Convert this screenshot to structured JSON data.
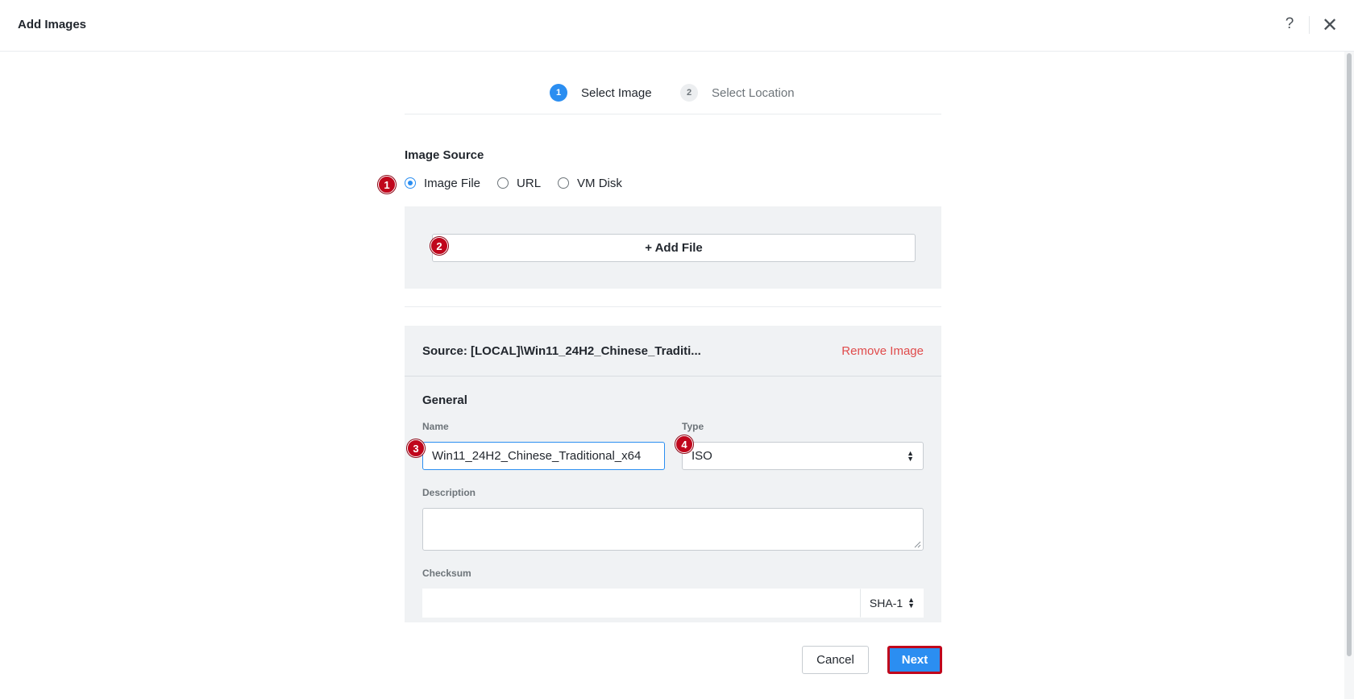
{
  "header": {
    "title": "Add Images",
    "help_icon": "question-mark-icon",
    "help_glyph": "?",
    "close_icon": "close-icon",
    "close_glyph": "✕"
  },
  "steps": [
    {
      "number": "1",
      "label": "Select Image",
      "state": "active"
    },
    {
      "number": "2",
      "label": "Select Location",
      "state": "inactive"
    }
  ],
  "image_source": {
    "title": "Image Source",
    "options": [
      {
        "label": "Image File",
        "checked": true
      },
      {
        "label": "URL",
        "checked": false
      },
      {
        "label": "VM Disk",
        "checked": false
      }
    ],
    "add_file_label": "+ Add File"
  },
  "source": {
    "text": "Source: [LOCAL]\\Win11_24H2_Chinese_Traditi...",
    "remove_label": "Remove Image"
  },
  "general": {
    "title": "General",
    "name_label": "Name",
    "name_value": "Win11_24H2_Chinese_Traditional_x64",
    "type_label": "Type",
    "type_value": "ISO",
    "description_label": "Description",
    "description_value": "",
    "checksum_label": "Checksum",
    "checksum_value": "",
    "checksum_algorithm": "SHA-1"
  },
  "footer": {
    "cancel_label": "Cancel",
    "next_label": "Next"
  },
  "annotations": {
    "markers": [
      "1",
      "2",
      "3",
      "4"
    ],
    "marker_color": "#c0061c"
  },
  "colors": {
    "accent": "#2b8ef1",
    "danger": "#e04b4b",
    "panel_bg": "#f0f2f4"
  }
}
